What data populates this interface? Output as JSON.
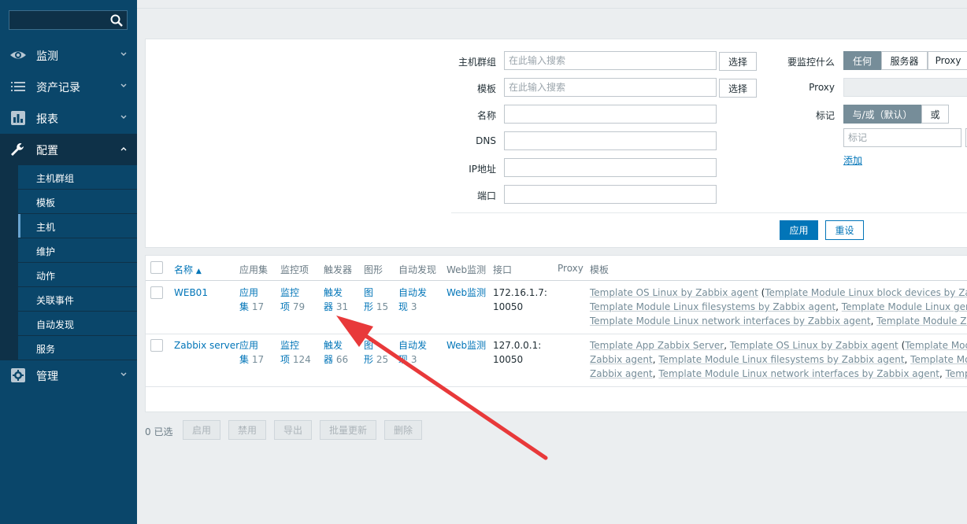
{
  "sidebar": {
    "search_placeholder": "",
    "menus": [
      {
        "label": "监测",
        "icon": "eye-icon"
      },
      {
        "label": "资产记录",
        "icon": "list-icon"
      },
      {
        "label": "报表",
        "icon": "bar-chart-icon"
      },
      {
        "label": "配置",
        "icon": "wrench-icon"
      },
      {
        "label": "管理",
        "icon": "gear-icon"
      }
    ],
    "config_items": [
      "主机群组",
      "模板",
      "主机",
      "维护",
      "动作",
      "关联事件",
      "自动发现",
      "服务"
    ],
    "active_item": "主机"
  },
  "filter": {
    "host_group_label": "主机群组",
    "template_label": "模板",
    "name_label": "名称",
    "dns_label": "DNS",
    "ip_label": "IP地址",
    "port_label": "端口",
    "search_placeholder": "在此输入搜索",
    "select_label": "选择",
    "monitored_by_label": "要监控什么",
    "monitored_by_options": [
      "任何",
      "服务器",
      "Proxy"
    ],
    "monitored_by_selected": "任何",
    "proxy_label": "Proxy",
    "tags_label": "标记",
    "tags_options": [
      "与/或（默认）",
      "或"
    ],
    "tags_selected": "与/或（默认）",
    "tag_placeholder": "标记",
    "add_label": "添加",
    "apply_label": "应用",
    "reset_label": "重设"
  },
  "table": {
    "headers": {
      "name": "名称",
      "applications": "应用集",
      "items": "监控项",
      "triggers": "触发器",
      "graphs": "图形",
      "discovery": "自动发现",
      "web": "Web监测",
      "interface": "接口",
      "proxy": "Proxy",
      "templates": "模板"
    },
    "rows": [
      {
        "name": "WEB01",
        "app_a": "应用",
        "app_b": "集",
        "app_n": "17",
        "item_a": "监控",
        "item_b": "项",
        "item_n": "79",
        "trig_a": "触发",
        "trig_b": "器",
        "trig_n": "31",
        "graph_a": "图",
        "graph_b": "形",
        "graph_n": "15",
        "disc_a": "自动发",
        "disc_b": "现",
        "disc_n": "3",
        "web": "Web监测",
        "iface_a": "172.16.1.7:",
        "iface_b": "10050",
        "tpl": {
          "t1": "Template OS Linux by Zabbix agent",
          "o1": " (",
          "t2": "Template Module Linux block devices by Zabbix agent",
          "o2": ", ",
          "t3": "Template Module Linux filesystems by Zabbix agent",
          "o3": ", ",
          "t4": "Template Module Linux generic by Zabbix agent",
          "o4": ", ",
          "t5": "Template Module Linux network interfaces by Zabbix agent",
          "o5": ", ",
          "t6": "Template Module Zabbix agent",
          "o6": ")"
        }
      },
      {
        "name": "Zabbix server",
        "app_a": "应用",
        "app_b": "集",
        "app_n": "17",
        "item_a": "监控",
        "item_b": "项",
        "item_n": "124",
        "trig_a": "触发",
        "trig_b": "器",
        "trig_n": "66",
        "graph_a": "图",
        "graph_b": "形",
        "graph_n": "25",
        "disc_a": "自动发",
        "disc_b": "现",
        "disc_n": "3",
        "web": "Web监测",
        "iface_a": "127.0.0.1:",
        "iface_b": "10050",
        "tpl": {
          "t1": "Template App Zabbix Server",
          "o1": ", ",
          "t2": "Template OS Linux by Zabbix agent",
          "o2": " (",
          "t3": "Template Module Linux",
          "o3": "",
          "t4": "Zabbix agent",
          "o4": ", ",
          "t5": "Template Module Linux filesystems by Zabbix agent",
          "o5": ", ",
          "t6": "Template Module Linux",
          "o6": "",
          "t7": "Zabbix agent",
          "o7": ", ",
          "t8": "Template Module Linux network interfaces by Zabbix agent",
          "o8": ", ",
          "t9": "Template Modul"
        }
      }
    ]
  },
  "footer": {
    "selected_count": "0 已选",
    "buttons": [
      "启用",
      "禁用",
      "导出",
      "批量更新",
      "删除"
    ]
  },
  "colors": {
    "sidebar_bg": "#0a466a",
    "accent": "#0275b8",
    "annotation_arrow": "#e8393a"
  }
}
